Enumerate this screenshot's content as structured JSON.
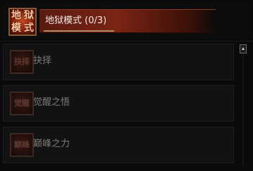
{
  "header": {
    "icon_glyphs": [
      "地",
      "狱",
      "模",
      "式"
    ],
    "label": "地狱模式 (0/3)"
  },
  "items": [
    {
      "label": "抉择",
      "icon_glyph": "抉择"
    },
    {
      "label": "觉醒之悟",
      "icon_glyph": "觉醒"
    },
    {
      "label": "巅峰之力",
      "icon_glyph": "巅峰"
    }
  ],
  "scrollbar": {
    "up_icon": "triangle-up-icon"
  },
  "colors": {
    "header_accent": "#7a2414",
    "header_icon_border": "#8a5a38",
    "item_text": "#7e7a76",
    "header_text": "#f4ece4"
  }
}
